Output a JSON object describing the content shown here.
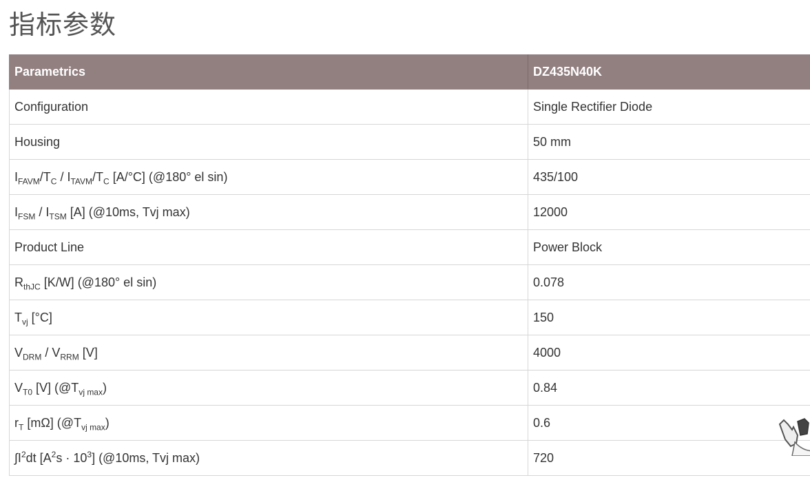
{
  "page": {
    "title": "指标参数"
  },
  "table": {
    "headers": {
      "col1": "Parametrics",
      "col2": "DZ435N40K"
    },
    "rows": [
      {
        "param": "Configuration",
        "value": "Single Rectifier Diode"
      },
      {
        "param": "Housing",
        "value": "50 mm"
      },
      {
        "param_parts": [
          "I",
          "FAVM",
          "/T",
          "C",
          " / I",
          "TAVM",
          "/T",
          "C",
          " [A/°C] (@180° el sin)"
        ],
        "param": "IFAVM/TC / ITAVM/TC [A/°C] (@180° el sin)",
        "value": "435/100"
      },
      {
        "param_parts": [
          "I",
          "FSM",
          " / I",
          "TSM",
          " [A] (@10ms, Tvj max)"
        ],
        "param": "IFSM / ITSM [A] (@10ms, Tvj max)",
        "value": "12000"
      },
      {
        "param": "Product Line",
        "value": "Power Block"
      },
      {
        "param_parts": [
          "R",
          "thJC",
          " [K/W] (@180° el sin)"
        ],
        "param": "RthJC [K/W] (@180° el sin)",
        "value": "0.078"
      },
      {
        "param_parts": [
          "T",
          "vj",
          " [°C]"
        ],
        "param": "Tvj [°C]",
        "value": "150"
      },
      {
        "param_parts": [
          "V",
          "DRM",
          " / V",
          "RRM",
          " [V]"
        ],
        "param": "VDRM / VRRM [V]",
        "value": "4000"
      },
      {
        "param_parts": [
          "V",
          "T0",
          " [V] (@T",
          "vj max",
          ")"
        ],
        "param": "VT0 [V] (@Tvj max)",
        "value": "0.84"
      },
      {
        "param_parts": [
          "r",
          "T",
          " [mΩ] (@T",
          "vj max",
          ")"
        ],
        "param": "rT [mΩ] (@Tvj max)",
        "value": "0.6"
      },
      {
        "param_parts": [
          "∫I",
          "2",
          "dt [A",
          "2",
          "s · 10",
          "3",
          "] (@10ms, Tvj max)"
        ],
        "param": "∫I2dt [A2s · 103] (@10ms, Tvj max)",
        "value": "720"
      }
    ]
  },
  "colors": {
    "header_bg": "#927f80",
    "header_text": "#ffffff",
    "border": "#d6d6d6",
    "text": "#333333"
  }
}
